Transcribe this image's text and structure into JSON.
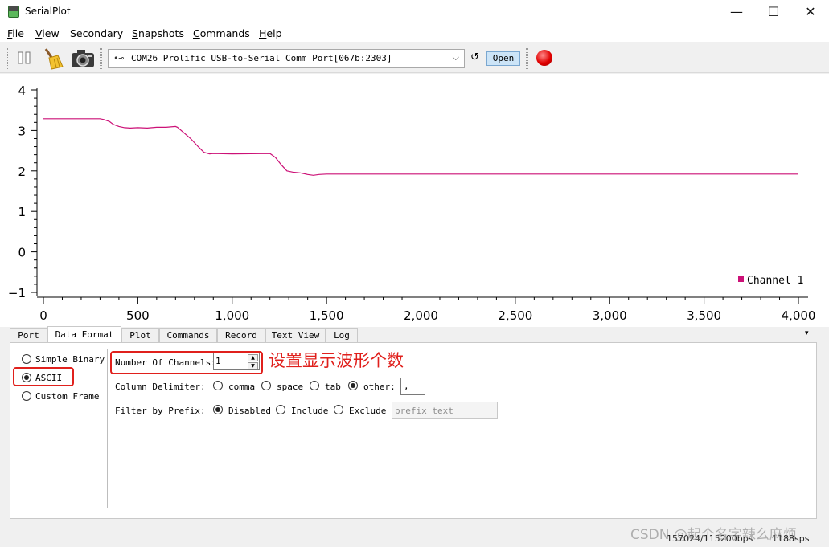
{
  "window": {
    "title": "SerialPlot",
    "controls": {
      "minimize": "—",
      "maximize": "☐",
      "close": "✕"
    }
  },
  "menu": [
    {
      "mnemonic": "F",
      "rest": "ile"
    },
    {
      "mnemonic": "V",
      "rest": "iew"
    },
    {
      "mnemonic": "",
      "rest": "Secondary"
    },
    {
      "mnemonic": "S",
      "rest": "napshots"
    },
    {
      "mnemonic": "C",
      "rest": "ommands"
    },
    {
      "mnemonic": "H",
      "rest": "elp"
    }
  ],
  "toolbar": {
    "icons": [
      "pause-icon",
      "broom-clear-icon",
      "camera-snapshot-icon",
      "usb-icon",
      "refresh-icon",
      "record-icon"
    ],
    "port_selected": "COM26 Prolific USB-to-Serial Comm Port[067b:2303]",
    "usb_glyph": "•⊸",
    "dropdown_glyph": "⌵",
    "refresh_glyph": "↺",
    "open_label": "Open",
    "record_color": "#e00000"
  },
  "chart_data": {
    "type": "line",
    "xlim": [
      0,
      4000
    ],
    "ylim": [
      -1,
      4
    ],
    "x_ticks": [
      "0",
      "500",
      "1,000",
      "1,500",
      "2,000",
      "2,500",
      "3,000",
      "3,500",
      "4,000"
    ],
    "y_ticks": [
      "4",
      "3",
      "2",
      "1",
      "0",
      "−1"
    ],
    "grid": false,
    "legend_position": "bottom-right",
    "series": [
      {
        "name": "Channel 1",
        "color": "#cc1177",
        "x": [
          0,
          300,
          320,
          350,
          370,
          400,
          430,
          460,
          500,
          550,
          600,
          650,
          700,
          710,
          740,
          780,
          820,
          850,
          880,
          900,
          1000,
          1200,
          1230,
          1260,
          1290,
          1320,
          1360,
          1400,
          1430,
          1460,
          1500,
          2000,
          3000,
          4000
        ],
        "y": [
          3.29,
          3.29,
          3.27,
          3.22,
          3.15,
          3.1,
          3.07,
          3.06,
          3.07,
          3.06,
          3.08,
          3.08,
          3.1,
          3.08,
          2.96,
          2.8,
          2.6,
          2.46,
          2.42,
          2.43,
          2.42,
          2.43,
          2.33,
          2.15,
          2.0,
          1.97,
          1.95,
          1.91,
          1.89,
          1.91,
          1.92,
          1.92,
          1.92,
          1.92
        ]
      }
    ]
  },
  "tabs": [
    {
      "label": "Port",
      "active": false
    },
    {
      "label": "Data Format",
      "active": true
    },
    {
      "label": "Plot",
      "active": false
    },
    {
      "label": "Commands",
      "active": false
    },
    {
      "label": "Record",
      "active": false
    },
    {
      "label": "Text View",
      "active": false
    },
    {
      "label": "Log",
      "active": false
    }
  ],
  "tab_menu_glyph": "▾",
  "data_format": {
    "formats": [
      {
        "label": "Simple Binary",
        "selected": false
      },
      {
        "label": "ASCII",
        "selected": true
      },
      {
        "label": "Custom Frame",
        "selected": false
      }
    ],
    "num_channels_label": "Number Of Channels:",
    "num_channels_value": "1",
    "spin_up": "▲",
    "spin_down": "▼",
    "delimiter_label": "Column Delimiter:",
    "delimiters": [
      {
        "label": "comma",
        "selected": false
      },
      {
        "label": "space",
        "selected": false
      },
      {
        "label": "tab",
        "selected": false
      },
      {
        "label": "other:",
        "selected": true
      }
    ],
    "delimiter_value": ",",
    "prefix_label": "Filter by Prefix:",
    "prefix_options": [
      {
        "label": "Disabled",
        "selected": true
      },
      {
        "label": "Include",
        "selected": false
      },
      {
        "label": "Exclude",
        "selected": false
      }
    ],
    "prefix_placeholder": "prefix text"
  },
  "annotation": {
    "text": "设置显示波形个数",
    "color": "#e0201c"
  },
  "status": {
    "baud": "157024/115200bps",
    "sps": "1188sps"
  },
  "watermark": "CSDN @起个名字辣么麻烦"
}
